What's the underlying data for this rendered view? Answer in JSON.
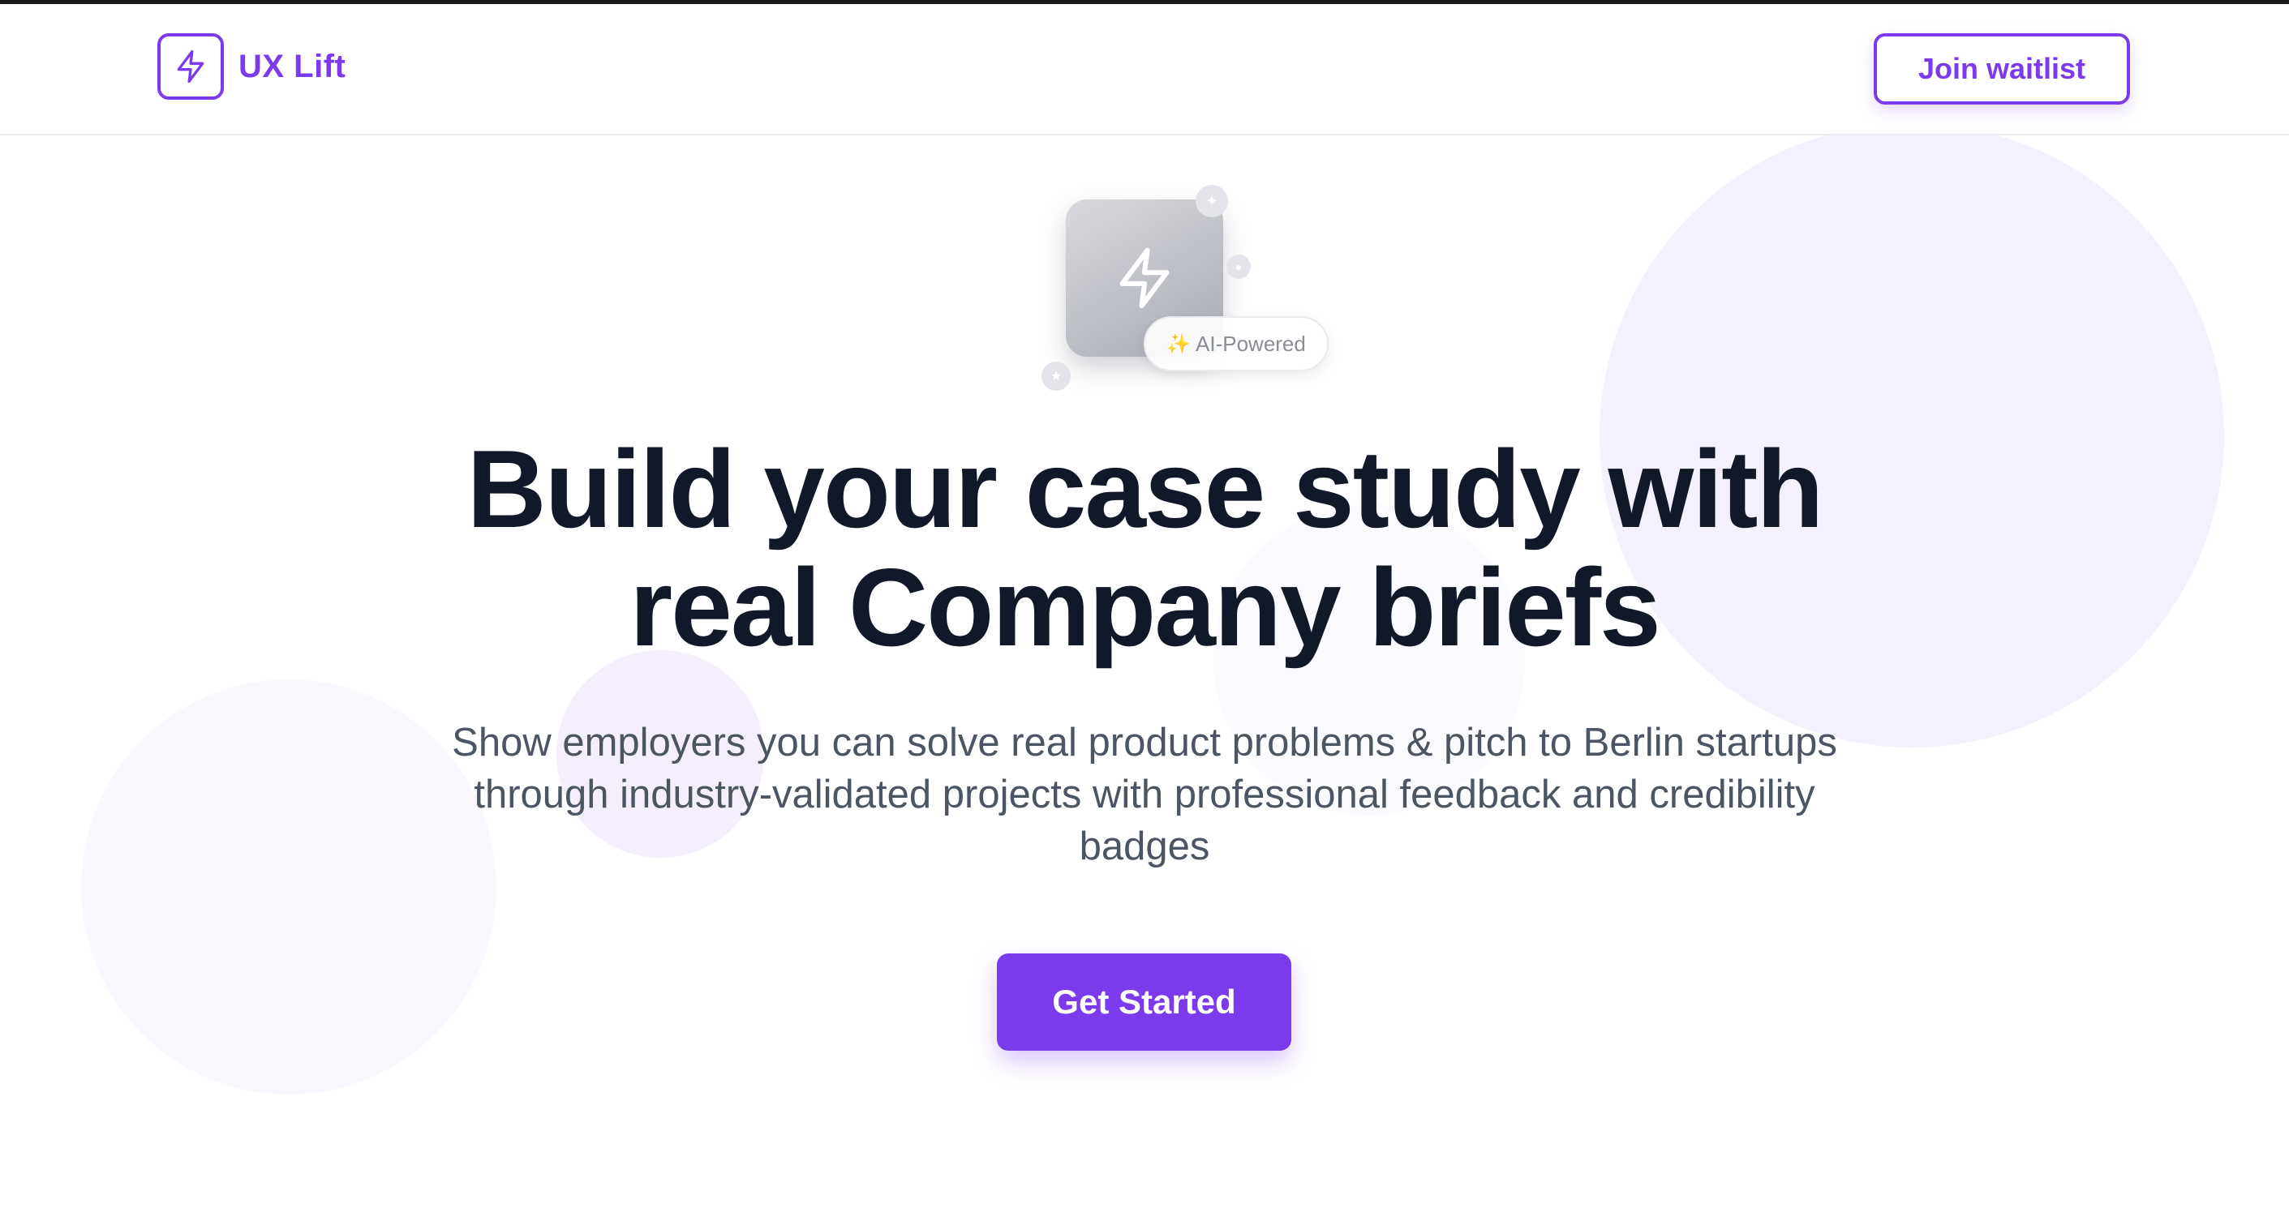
{
  "header": {
    "logo_text": "UX Lift",
    "logo_icon": "lightning-icon",
    "waitlist_label": "Join waitlist"
  },
  "hero": {
    "icon": "lightning-icon",
    "badge_sparkle": "✨",
    "badge_label": "AI-Powered",
    "headline_line1": "Build your case study with",
    "headline_line2": "real Company briefs",
    "subtitle": "Show employers you can solve real product problems & pitch to Berlin startups through industry-validated projects with professional feedback and credibility badges",
    "cta_label": "Get Started"
  },
  "colors": {
    "brand": "#7c3aed",
    "headline": "#111827",
    "body_text": "#4b5563",
    "decor_circle": "#f5f0fd"
  }
}
